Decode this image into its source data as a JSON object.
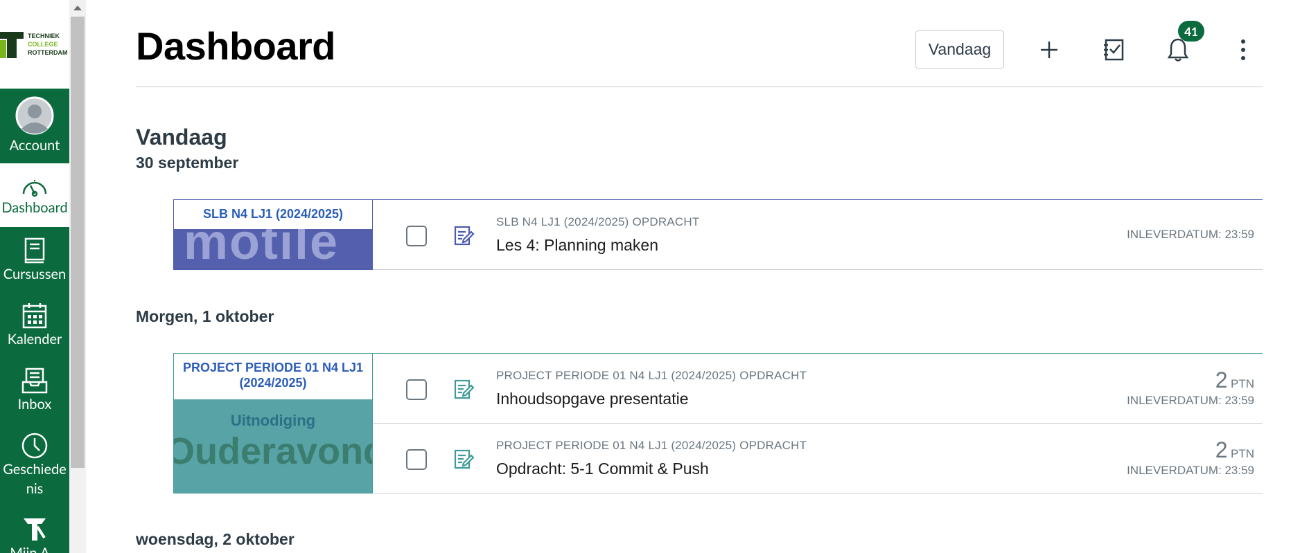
{
  "logo": {
    "line1": "TECHNIEK",
    "line2": "COLLEGE",
    "line3": "ROTTERDAM"
  },
  "nav": {
    "account": "Account",
    "dashboard": "Dashboard",
    "courses": "Cursussen",
    "calendar": "Kalender",
    "inbox": "Inbox",
    "history": "Geschiede nis",
    "my_account": "Mijn A..."
  },
  "header": {
    "title": "Dashboard",
    "today_button": "Vandaag",
    "notifications_count": "41"
  },
  "sections": [
    {
      "heading": "Vandaag",
      "date": "30 september"
    },
    {
      "heading": "Morgen, 1 oktober"
    },
    {
      "heading": "woensdag, 2 oktober"
    }
  ],
  "groups": [
    {
      "course": "SLB N4 LJ1 (2024/2025)",
      "color": "#4c5bae",
      "image_text": "motile",
      "items": [
        {
          "context": "SLB N4 LJ1 (2024/2025) OPDRACHT",
          "title": "Les 4: Planning maken",
          "due": "INLEVERDATUM: 23:59"
        }
      ]
    },
    {
      "course": "PROJECT PERIODE 01 N4 LJ1 (2024/2025)",
      "color": "#3f9a98",
      "image_text_1": "Uitnodiging",
      "image_text_2": "Ouderavond",
      "items": [
        {
          "context": "PROJECT PERIODE 01 N4 LJ1 (2024/2025) OPDRACHT",
          "title": "Inhoudsopgave presentatie",
          "points": "2",
          "points_unit": "PTN",
          "due": "INLEVERDATUM: 23:59"
        },
        {
          "context": "PROJECT PERIODE 01 N4 LJ1 (2024/2025) OPDRACHT",
          "title": "Opdracht: 5-1 Commit & Push",
          "points": "2",
          "points_unit": "PTN",
          "due": "INLEVERDATUM: 23:59"
        }
      ]
    }
  ]
}
